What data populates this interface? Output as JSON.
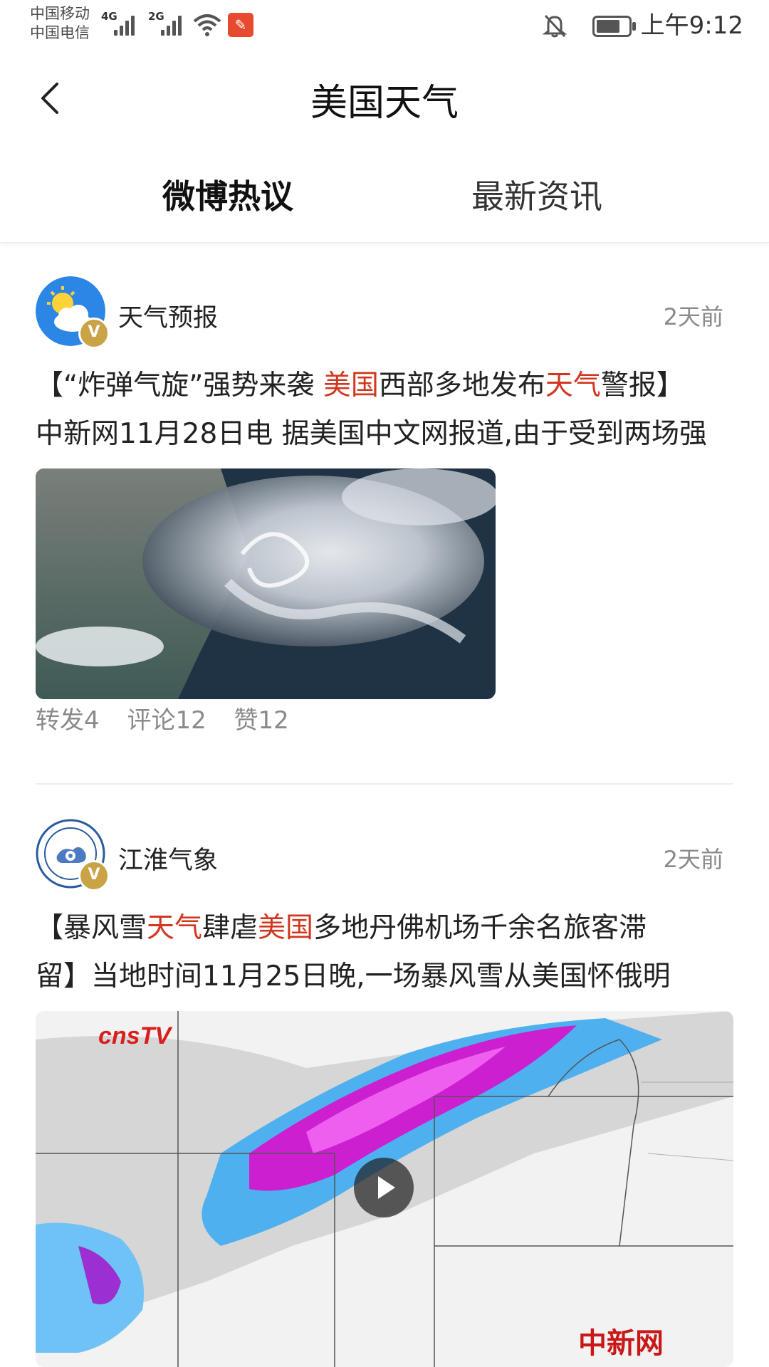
{
  "status_bar": {
    "carrier_1": "中国移动",
    "carrier_2": "中国电信",
    "signal_1_label": "4G",
    "signal_2_label": "2G",
    "time": "上午9:12"
  },
  "header": {
    "title": "美国天气"
  },
  "tabs": [
    {
      "label": "微博热议",
      "active": true
    },
    {
      "label": "最新资讯",
      "active": false
    }
  ],
  "posts": [
    {
      "author": "天气预报",
      "time": "2天前",
      "text_parts": [
        "【“炸弹气旋”强势来袭 ",
        "美国",
        "西部多地发布",
        "天气",
        "警报】"
      ],
      "text_line2": "中新网11月28日电 据美国中文网报道,由于受到两场强",
      "image_icon": "satellite-storm-image",
      "repost": "转发4",
      "comment": "评论12",
      "like": "赞12"
    },
    {
      "author": "江淮气象",
      "time": "2天前",
      "text_parts": [
        "【暴风雪",
        "天气",
        "肆虐",
        "美国",
        "多地丹佛机场千余名旅客滞"
      ],
      "text_line2": "留】当地时间11月25日晚,一场暴风雪从美国怀俄明",
      "video_watermark_1": "cnsTV",
      "video_watermark_2": "中新网",
      "image_icon": "snowfall-map-video"
    }
  ],
  "colors": {
    "highlight": "#d2361f",
    "muted": "#8a8a8a",
    "verified_badge": "#c9a346"
  }
}
